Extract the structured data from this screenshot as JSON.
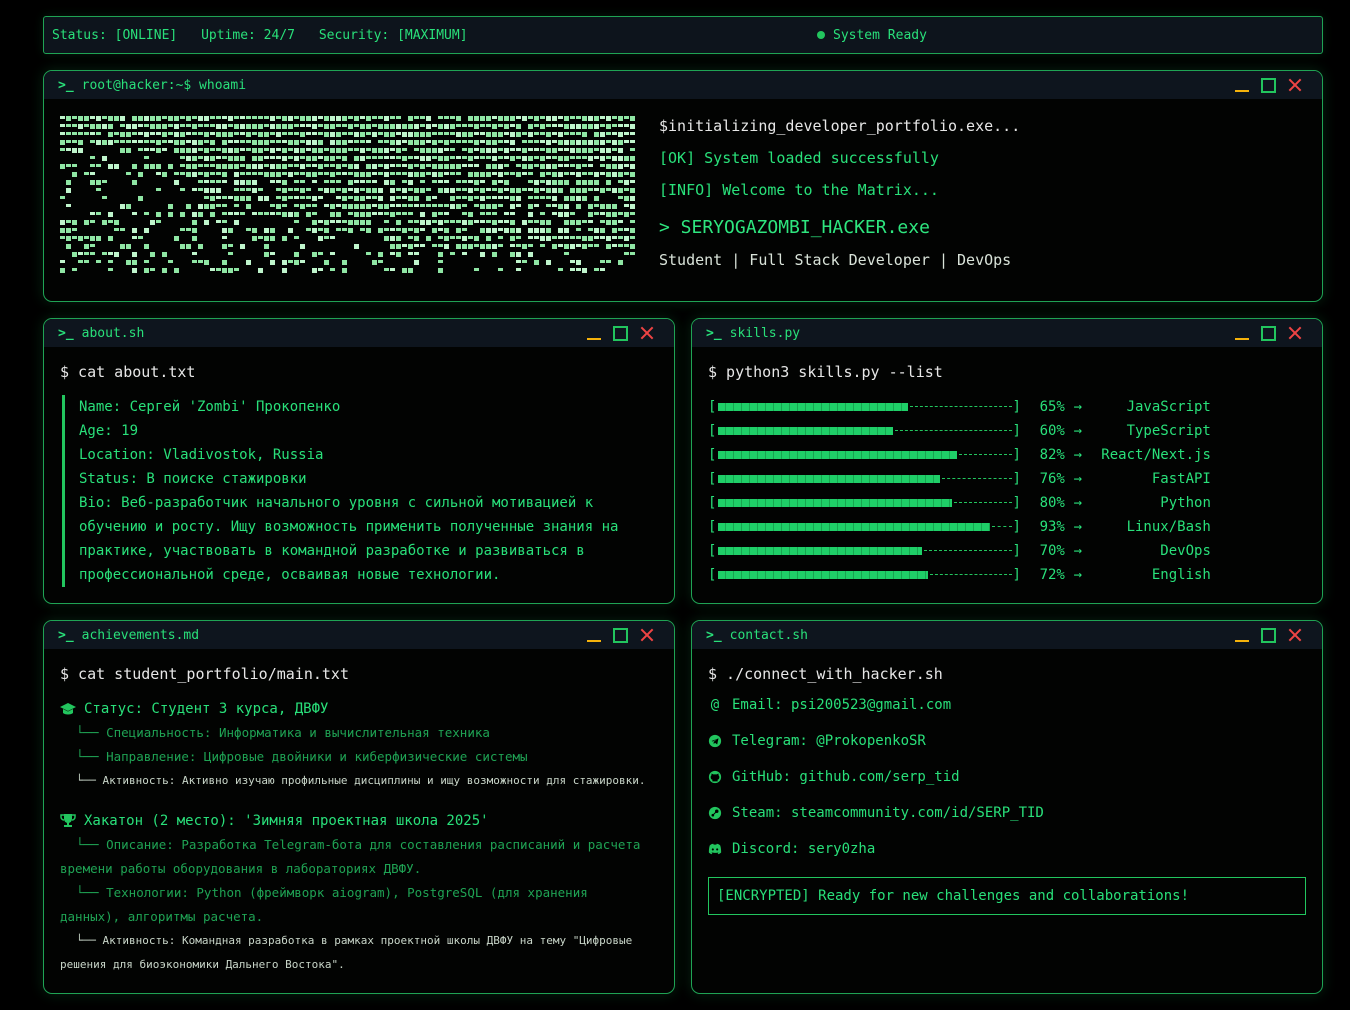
{
  "status_bar": {
    "status": "Status: [ONLINE]",
    "uptime": "Uptime: 24/7",
    "security": "Security: [MAXIMUM]",
    "ready": "System Ready"
  },
  "whoami": {
    "title": "root@hacker:~$ whoami",
    "lines": [
      "$initializing_developer_portfolio.exe...",
      "[OK] System loaded successfully",
      "[INFO] Welcome to the Matrix..."
    ],
    "hacker_name": "> SERYOGAZOMBI_HACKER.exe",
    "subtitle": "Student | Full Stack Developer | DevOps"
  },
  "about": {
    "title": "about.sh",
    "command": "$ cat about.txt",
    "name": "Name: Сергей 'Zombi' Прокопенко",
    "age": "Age: 19",
    "location": "Location: Vladivostok, Russia",
    "status": "Status: В поиске стажировки",
    "bio": "Bio: Веб-разработчик начального уровня с сильной мотивацией к обучению и росту. Ищу возможность применить полученные знания на практике, участвовать в командной разработке и развиваться в профессиональной среде, осваивая новые технологии."
  },
  "skills": {
    "title": "skills.py",
    "command": "$ python3 skills.py --list",
    "items": [
      {
        "pct_label": "65%",
        "value": 65,
        "name": "JavaScript"
      },
      {
        "pct_label": "60%",
        "value": 60,
        "name": "TypeScript"
      },
      {
        "pct_label": "82%",
        "value": 82,
        "name": "React/Next.js"
      },
      {
        "pct_label": "76%",
        "value": 76,
        "name": "FastAPI"
      },
      {
        "pct_label": "80%",
        "value": 80,
        "name": "Python"
      },
      {
        "pct_label": "93%",
        "value": 93,
        "name": "Linux/Bash"
      },
      {
        "pct_label": "70%",
        "value": 70,
        "name": "DevOps"
      },
      {
        "pct_label": "72%",
        "value": 72,
        "name": "English"
      }
    ]
  },
  "achievements": {
    "title": "achievements.md",
    "command": "$ cat student_portfolio/main.txt",
    "status_title": "Статус: Студент 3 курса, ДВФУ",
    "spec": "└── Специальность: Информатика и вычислительная техника",
    "direction": "└── Направление: Цифровые двойники и киберфизические системы",
    "activity": "└── Активность: Активно изучаю профильные дисциплины и ищу возможности для стажировки.",
    "hack_title": "Хакатон (2 место): 'Зимняя проектная школа 2025'",
    "hack_desc_1": "└── Описание: Разработка Telegram-бота для составления расписаний и расчета",
    "hack_desc_2": "времени работы оборудования в лабораториях ДВФУ.",
    "hack_tech_1": "└── Технологии: Python (фреймворк aiogram), PostgreSQL (для хранения",
    "hack_tech_2": "данных), алгоритмы расчета.",
    "hack_act_1": "└── Активность: Командная разработка в рамках проектной школы ДВФУ на тему \"Цифровые",
    "hack_act_2": "решения для биоэкономики Дальнего Востока\"."
  },
  "contact": {
    "title": "contact.sh",
    "command": "$ ./connect_with_hacker.sh",
    "email": "Email: psi200523@gmail.com",
    "telegram": "Telegram: @ProkopenkoSR",
    "github": "GitHub: github.com/serp_tid",
    "steam": "Steam: steamcommunity.com/id/SERP_TID",
    "discord": "Discord: sery0zha",
    "encrypted": "[ENCRYPTED] Ready for new challenges and collaborations!"
  },
  "icons": {
    "prompt": "terminal-prompt-icon",
    "minimize": "minimize-icon",
    "maximize": "maximize-icon",
    "close": "close-icon"
  },
  "colors": {
    "accent": "#22c55e",
    "minimize": "#f5b20b",
    "close": "#ef4444"
  }
}
